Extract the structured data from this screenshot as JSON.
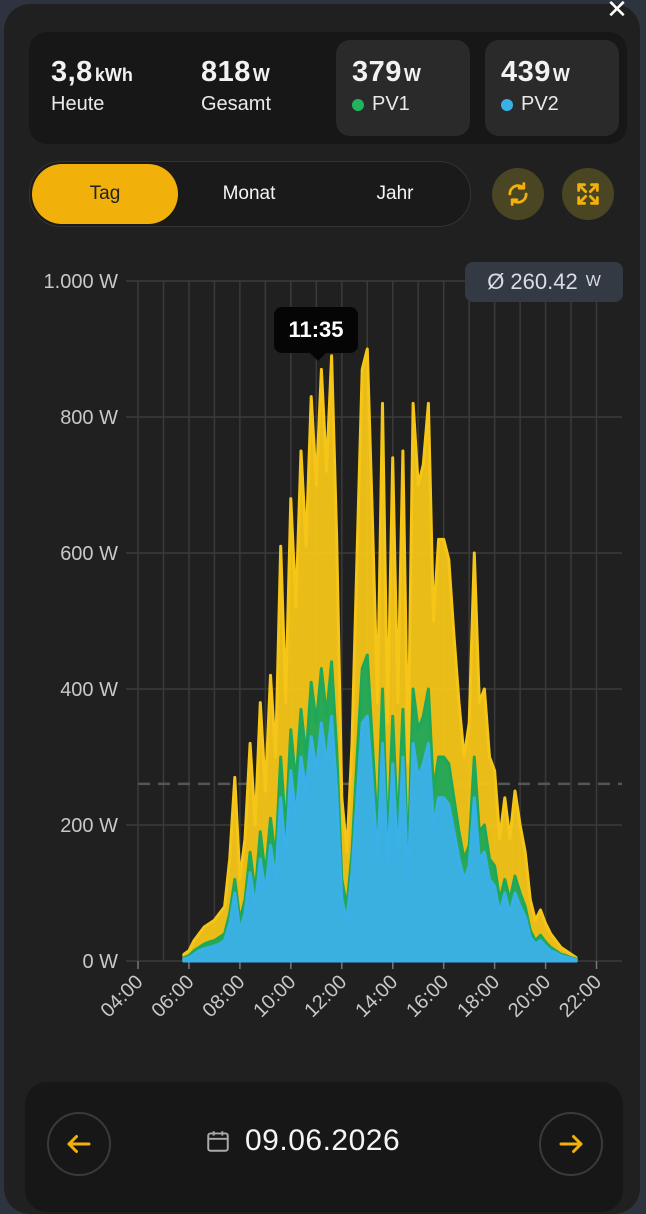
{
  "header": {
    "close_icon": "close-icon"
  },
  "stats": {
    "today": {
      "value": "3,8",
      "unit": "kWh",
      "label": "Heute"
    },
    "total": {
      "value": "818",
      "unit": "W",
      "label": "Gesamt"
    },
    "pv1": {
      "value": "379",
      "unit": "W",
      "label": "PV1",
      "color": "#22b35e"
    },
    "pv2": {
      "value": "439",
      "unit": "W",
      "label": "PV2",
      "color": "#3ab0e8"
    }
  },
  "tabs": [
    {
      "label": "Tag",
      "active": true
    },
    {
      "label": "Monat",
      "active": false
    },
    {
      "label": "Jahr",
      "active": false
    }
  ],
  "actions": {
    "refresh_icon": "refresh-icon",
    "fullscreen_icon": "fullscreen-icon"
  },
  "average": {
    "symbol": "Ø",
    "value": "260.42",
    "unit": "W",
    "text": "Ø 260.42"
  },
  "tooltip": {
    "time": "11:35"
  },
  "chart_data": {
    "type": "area",
    "xlim": [
      4,
      23
    ],
    "ylim": [
      0,
      1000
    ],
    "yticks": [
      0,
      200,
      400,
      600,
      800,
      1000
    ],
    "ytick_labels": [
      "0 W",
      "200 W",
      "400 W",
      "600 W",
      "800 W",
      "1.000 W"
    ],
    "xtick_labels": [
      "04:00",
      "06:00",
      "08:00",
      "10:00",
      "12:00",
      "14:00",
      "16:00",
      "18:00",
      "20:00",
      "22:00"
    ],
    "average_line": 260.42,
    "colors": {
      "total": "#f5c518",
      "pv1": "#1fa85a",
      "pv2": "#3ab0e8",
      "grid": "#3a3a3a"
    },
    "series": [
      {
        "name": "Gesamt",
        "x": [
          5.8,
          6.0,
          6.2,
          6.4,
          6.6,
          6.8,
          7.0,
          7.2,
          7.4,
          7.6,
          7.8,
          8.0,
          8.2,
          8.4,
          8.6,
          8.8,
          9.0,
          9.2,
          9.4,
          9.6,
          9.8,
          10.0,
          10.2,
          10.4,
          10.6,
          10.8,
          11.0,
          11.2,
          11.4,
          11.6,
          11.8,
          12.0,
          12.2,
          12.4,
          12.6,
          12.8,
          13.0,
          13.2,
          13.4,
          13.6,
          13.8,
          14.0,
          14.2,
          14.4,
          14.6,
          14.8,
          15.0,
          15.2,
          15.4,
          15.6,
          15.8,
          16.0,
          16.2,
          16.4,
          16.6,
          16.8,
          17.0,
          17.2,
          17.4,
          17.6,
          17.8,
          18.0,
          18.2,
          18.4,
          18.6,
          18.8,
          19.0,
          19.2,
          19.4,
          19.6,
          19.8,
          20.0,
          20.2,
          20.4,
          20.6,
          20.8,
          21.0,
          21.2
        ],
        "values": [
          10,
          15,
          30,
          40,
          50,
          55,
          60,
          70,
          80,
          150,
          270,
          120,
          180,
          320,
          200,
          380,
          250,
          420,
          300,
          610,
          380,
          680,
          520,
          750,
          610,
          830,
          700,
          870,
          720,
          890,
          620,
          240,
          160,
          320,
          600,
          870,
          900,
          650,
          380,
          820,
          350,
          740,
          380,
          750,
          290,
          820,
          700,
          730,
          820,
          500,
          620,
          620,
          590,
          480,
          380,
          300,
          350,
          600,
          380,
          400,
          300,
          280,
          180,
          240,
          180,
          250,
          200,
          160,
          90,
          60,
          75,
          55,
          40,
          30,
          20,
          15,
          10,
          5
        ]
      },
      {
        "name": "PV1",
        "x": [
          5.8,
          6.0,
          6.2,
          6.4,
          6.6,
          6.8,
          7.0,
          7.2,
          7.4,
          7.6,
          7.8,
          8.0,
          8.2,
          8.4,
          8.6,
          8.8,
          9.0,
          9.2,
          9.4,
          9.6,
          9.8,
          10.0,
          10.2,
          10.4,
          10.6,
          10.8,
          11.0,
          11.2,
          11.4,
          11.6,
          11.8,
          12.0,
          12.2,
          12.4,
          12.6,
          12.8,
          13.0,
          13.2,
          13.4,
          13.6,
          13.8,
          14.0,
          14.2,
          14.4,
          14.6,
          14.8,
          15.0,
          15.2,
          15.4,
          15.6,
          15.8,
          16.0,
          16.2,
          16.4,
          16.6,
          16.8,
          17.0,
          17.2,
          17.4,
          17.6,
          17.8,
          18.0,
          18.2,
          18.4,
          18.6,
          18.8,
          19.0,
          19.2,
          19.4,
          19.6,
          19.8,
          20.0,
          20.2,
          20.4,
          20.6,
          20.8,
          21.0,
          21.2
        ],
        "values": [
          5,
          8,
          15,
          20,
          25,
          28,
          30,
          35,
          40,
          70,
          120,
          60,
          90,
          160,
          100,
          190,
          125,
          210,
          150,
          300,
          190,
          340,
          260,
          370,
          300,
          410,
          350,
          430,
          360,
          440,
          310,
          120,
          80,
          160,
          300,
          430,
          450,
          320,
          190,
          400,
          170,
          360,
          190,
          370,
          140,
          400,
          340,
          360,
          400,
          250,
          300,
          300,
          290,
          240,
          190,
          150,
          170,
          300,
          190,
          200,
          150,
          140,
          90,
          120,
          90,
          125,
          100,
          80,
          45,
          30,
          38,
          28,
          20,
          15,
          10,
          8,
          5,
          3
        ]
      },
      {
        "name": "PV2",
        "x": [
          5.8,
          6.0,
          6.2,
          6.4,
          6.6,
          6.8,
          7.0,
          7.2,
          7.4,
          7.6,
          7.8,
          8.0,
          8.2,
          8.4,
          8.6,
          8.8,
          9.0,
          9.2,
          9.4,
          9.6,
          9.8,
          10.0,
          10.2,
          10.4,
          10.6,
          10.8,
          11.0,
          11.2,
          11.4,
          11.6,
          11.8,
          12.0,
          12.2,
          12.4,
          12.6,
          12.8,
          13.0,
          13.2,
          13.4,
          13.6,
          13.8,
          14.0,
          14.2,
          14.4,
          14.6,
          14.8,
          15.0,
          15.2,
          15.4,
          15.6,
          15.8,
          16.0,
          16.2,
          16.4,
          16.6,
          16.8,
          17.0,
          17.2,
          17.4,
          17.6,
          17.8,
          18.0,
          18.2,
          18.4,
          18.6,
          18.8,
          19.0,
          19.2,
          19.4,
          19.6,
          19.8,
          20.0,
          20.2,
          20.4,
          20.6,
          20.8,
          21.0,
          21.2
        ],
        "values": [
          3,
          5,
          10,
          15,
          18,
          20,
          22,
          25,
          30,
          55,
          100,
          45,
          70,
          130,
          80,
          150,
          100,
          170,
          120,
          240,
          150,
          280,
          210,
          300,
          250,
          330,
          280,
          350,
          290,
          360,
          250,
          90,
          60,
          130,
          240,
          350,
          360,
          260,
          150,
          320,
          140,
          290,
          150,
          300,
          110,
          320,
          270,
          290,
          320,
          200,
          240,
          240,
          230,
          190,
          150,
          120,
          140,
          240,
          150,
          160,
          120,
          110,
          70,
          100,
          70,
          100,
          80,
          65,
          35,
          25,
          30,
          22,
          15,
          12,
          8,
          6,
          4,
          2
        ]
      }
    ]
  },
  "navigation": {
    "prev_icon": "arrow-left-icon",
    "next_icon": "arrow-right-icon",
    "calendar_icon": "calendar-icon",
    "date": "09.06.2026"
  }
}
